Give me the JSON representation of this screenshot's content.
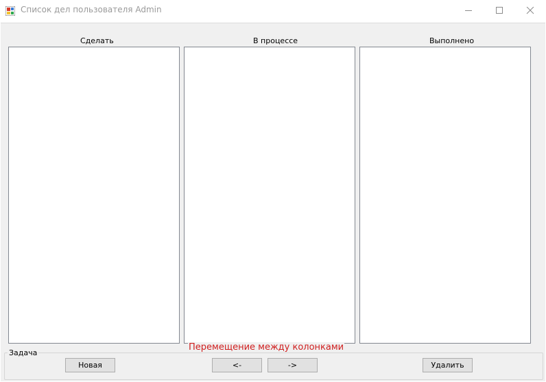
{
  "window": {
    "title": "Список дел пользователя Admin",
    "app_icon": "winforms-app-icon",
    "controls": [
      "minimize-icon",
      "maximize-icon",
      "close-icon"
    ]
  },
  "columns": [
    {
      "label": "Сделать",
      "items": []
    },
    {
      "label": "В процессе",
      "items": []
    },
    {
      "label": "Выполнено",
      "items": []
    }
  ],
  "task_group": {
    "legend": "Задача",
    "move_label": "Перемещение между колонками",
    "new_button": "Новая",
    "move_left_button": "<-",
    "move_right_button": "->",
    "delete_button": "Удалить"
  },
  "colors": {
    "move_label": "#d01f1f",
    "client_background": "#f0f0f0",
    "button_face": "#e1e1e1"
  }
}
